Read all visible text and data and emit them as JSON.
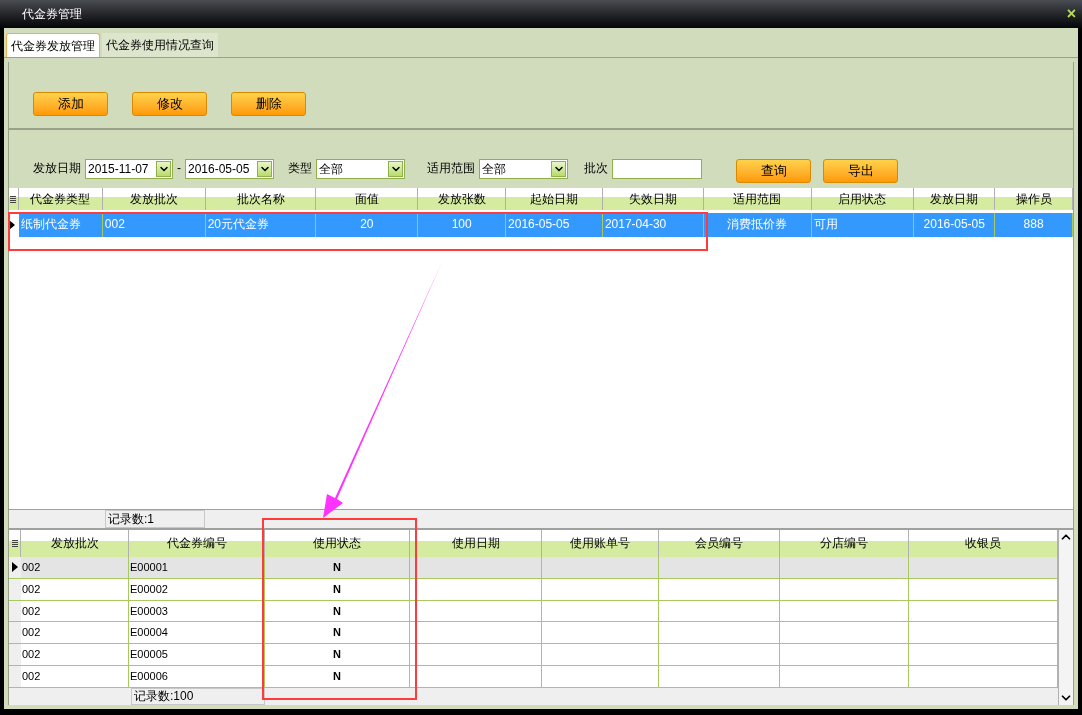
{
  "window": {
    "title": "代金券管理",
    "close": "×"
  },
  "tabs": [
    {
      "label": "代金券发放管理",
      "selected": true
    },
    {
      "label": "代金券使用情况查询",
      "selected": false
    }
  ],
  "actions": [
    "添加",
    "修改",
    "删除"
  ],
  "filters": {
    "date_label": "发放日期",
    "date_from": "2015-11-07",
    "date_sep": "-",
    "date_to": "2016-05-05",
    "type_label": "类型",
    "type_value": "全部",
    "scope_label": "适用范围",
    "scope_value": "全部",
    "batch_label": "批次"
  },
  "filter_buttons": [
    "查询",
    "导出"
  ],
  "issue_table": {
    "columns": [
      "代金券类型",
      "发放批次",
      "批次名称",
      "面值",
      "发放张数",
      "起始日期",
      "失效日期",
      "适用范围",
      "启用状态",
      "发放日期",
      "操作员"
    ],
    "rows": [
      {
        "selected": true,
        "cells": [
          "纸制代金券",
          "002",
          "20元代金券",
          "20",
          "100",
          "2016-05-05",
          "2017-04-30",
          "消费抵价券",
          "可用",
          "2016-05-05",
          "888"
        ]
      }
    ],
    "footer": "记录数:1"
  },
  "usage_table": {
    "columns": [
      "发放批次",
      "代金券编号",
      "使用状态",
      "使用日期",
      "使用账单号",
      "会员编号",
      "分店编号",
      "收银员"
    ],
    "rows": [
      {
        "selected": true,
        "cells": [
          "002",
          "E00001",
          "N"
        ]
      },
      {
        "selected": false,
        "cells": [
          "002",
          "E00002",
          "N"
        ]
      },
      {
        "selected": false,
        "cells": [
          "002",
          "E00003",
          "N"
        ]
      },
      {
        "selected": false,
        "cells": [
          "002",
          "E00004",
          "N"
        ]
      },
      {
        "selected": false,
        "cells": [
          "002",
          "E00005",
          "N"
        ]
      },
      {
        "selected": false,
        "cells": [
          "002",
          "E00006",
          "N"
        ]
      }
    ],
    "footer": "记录数:100"
  }
}
